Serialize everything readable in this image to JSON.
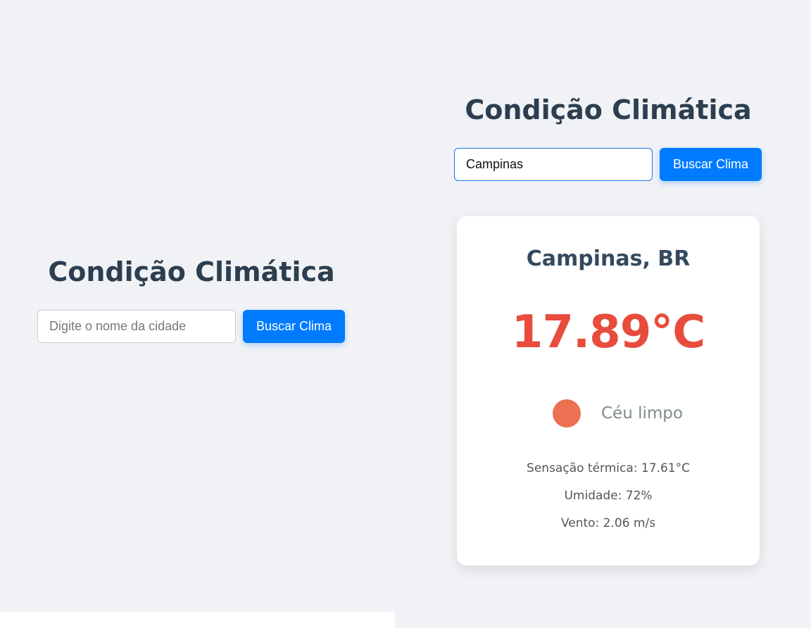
{
  "left_view": {
    "title": "Condição Climática",
    "search": {
      "value": "",
      "placeholder": "Digite o nome da cidade",
      "button_label": "Buscar Clima"
    }
  },
  "right_view": {
    "title": "Condição Climática",
    "search": {
      "value": "Campinas",
      "placeholder": "Digite o nome da cidade",
      "button_label": "Buscar Clima"
    },
    "result": {
      "location": "Campinas, BR",
      "temperature": "17.89°C",
      "condition_icon": "sun-icon",
      "condition": "Céu limpo",
      "feels_like": "Sensação térmica: 17.61°C",
      "humidity": "Umidade: 72%",
      "wind": "Vento: 2.06 m/s"
    }
  },
  "colors": {
    "background": "#f0f2f5",
    "primary": "#007bff",
    "title": "#2c3e50",
    "temperature": "#e74c3c",
    "sun": "#ec7052"
  }
}
